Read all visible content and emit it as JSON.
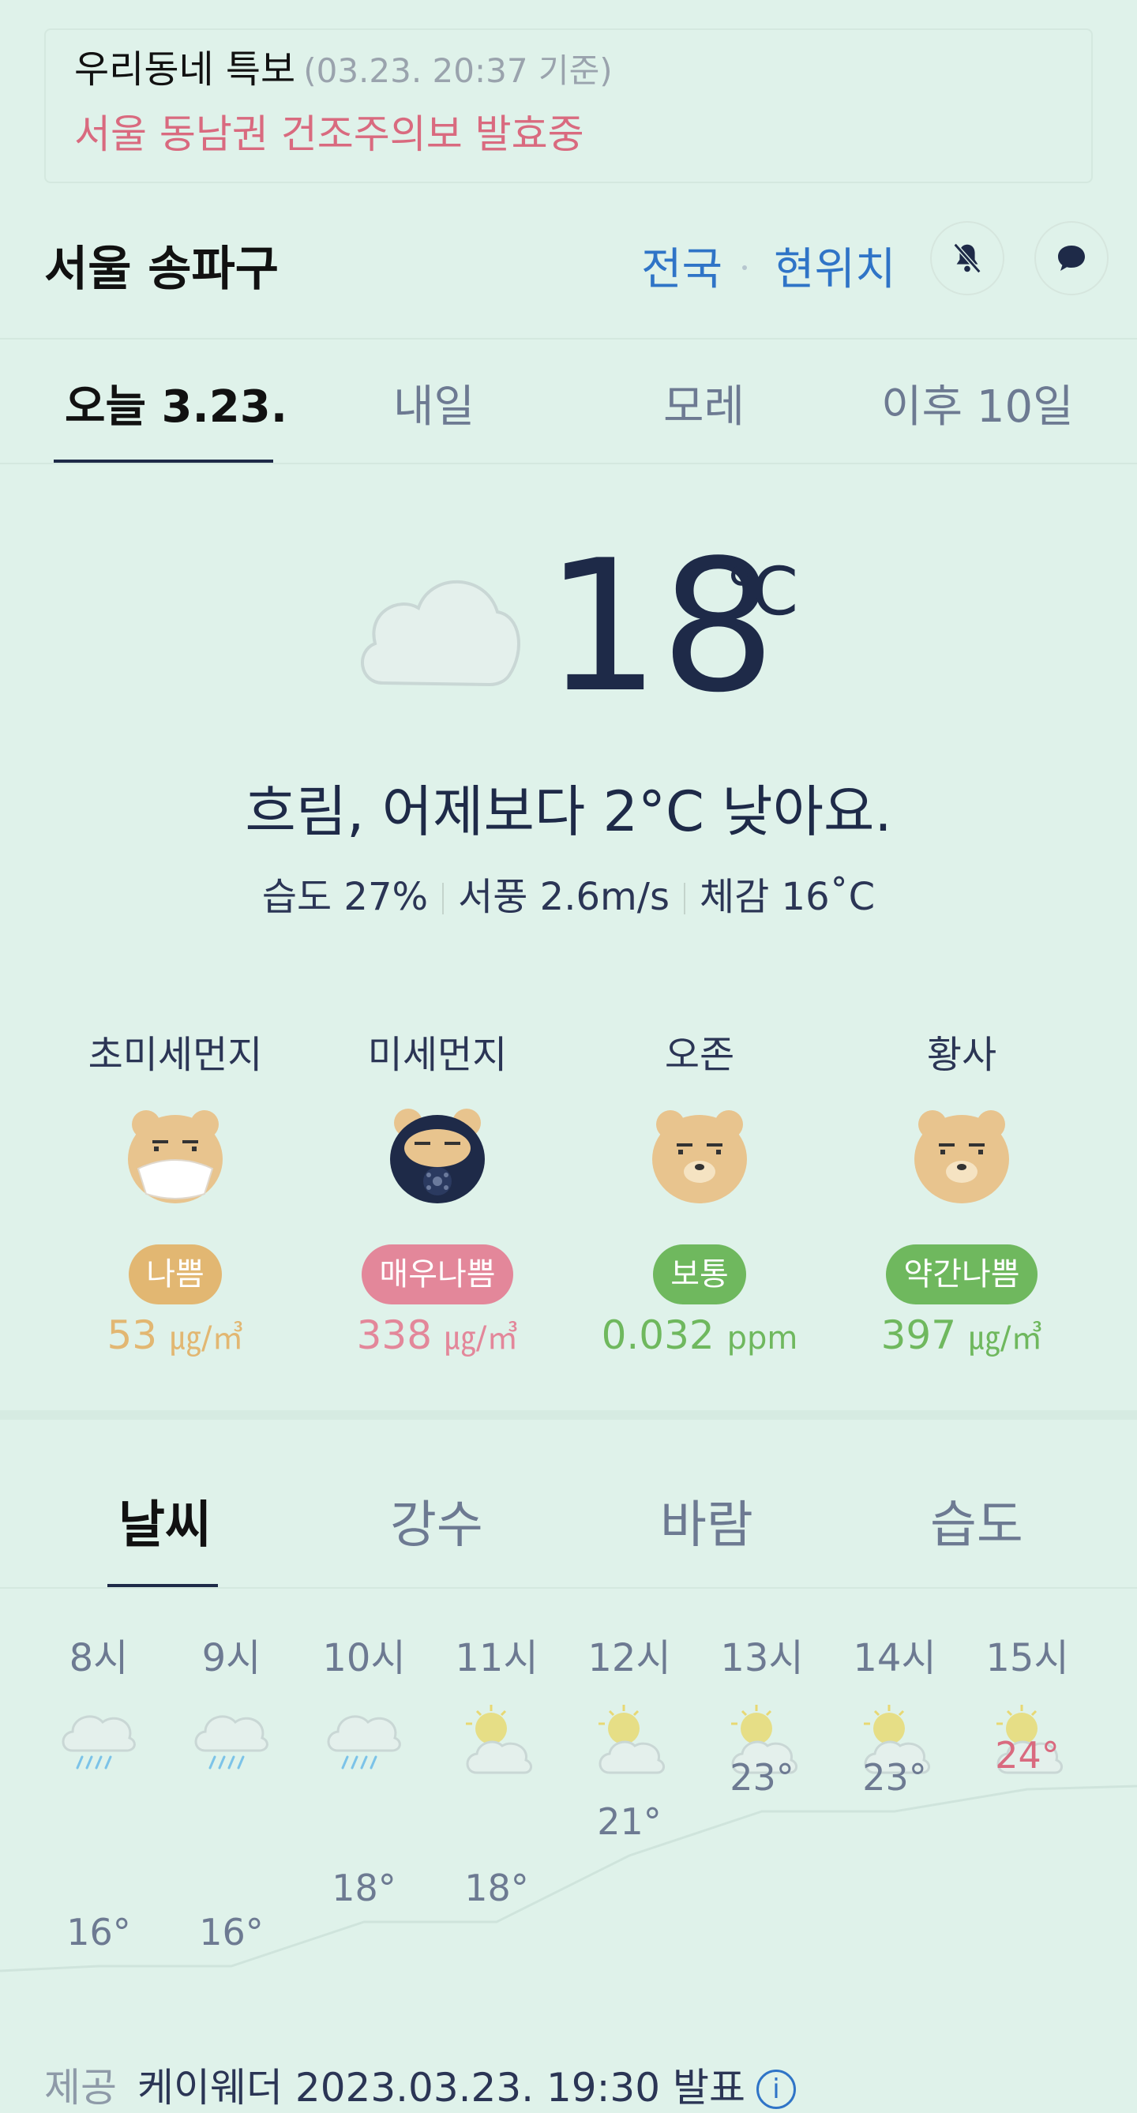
{
  "alert": {
    "title": "우리동네 특보",
    "time": "(03.23. 20:37 기준)",
    "message": "서울 동남권 건조주의보 발효중"
  },
  "header": {
    "location": "서울 송파구",
    "nation_link": "전국",
    "current_link": "현위치",
    "bell_icon": "bell-muted-icon",
    "chat_icon": "chat-bubble-icon"
  },
  "day_tabs": [
    "오늘 3.23.",
    "내일",
    "모레",
    "이후 10일"
  ],
  "current": {
    "icon": "cloud-icon",
    "temperature": "18",
    "unit": "℃",
    "summary": "흐림, 어제보다 2°C 낮아요.",
    "humidity": "습도 27%",
    "wind": "서풍 2.6m/s",
    "feels_like": "체감 16˚C"
  },
  "air_quality": [
    {
      "label": "초미세먼지",
      "status": "나쁨",
      "value": "53",
      "unit": "㎍/㎥",
      "color": "#e2b772",
      "face": "bear-mask-icon"
    },
    {
      "label": "미세먼지",
      "status": "매우나쁨",
      "value": "338",
      "unit": "㎍/㎥",
      "color": "#e3879a",
      "face": "bear-gasmask-icon"
    },
    {
      "label": "오존",
      "status": "보통",
      "value": "0.032",
      "unit": "ppm",
      "color": "#6fb85e",
      "face": "bear-icon"
    },
    {
      "label": "황사",
      "status": "약간나쁨",
      "value": "397",
      "unit": "㎍/㎥",
      "color": "#6fb85e",
      "face": "bear-icon"
    }
  ],
  "forecast_tabs": [
    "날씨",
    "강수",
    "바람",
    "습도"
  ],
  "hourly": [
    {
      "hour": "8시",
      "icon": "rain-icon",
      "temp": "16°",
      "value": 16
    },
    {
      "hour": "9시",
      "icon": "rain-icon",
      "temp": "16°",
      "value": 16
    },
    {
      "hour": "10시",
      "icon": "rain-icon",
      "temp": "18°",
      "value": 18
    },
    {
      "hour": "11시",
      "icon": "partly-sunny-icon",
      "temp": "18°",
      "value": 18
    },
    {
      "hour": "12시",
      "icon": "partly-sunny-icon",
      "temp": "21°",
      "value": 21
    },
    {
      "hour": "13시",
      "icon": "partly-sunny-icon",
      "temp": "23°",
      "value": 23
    },
    {
      "hour": "14시",
      "icon": "partly-sunny-icon",
      "temp": "23°",
      "value": 23
    },
    {
      "hour": "15시",
      "icon": "partly-sunny-icon",
      "temp": "24°",
      "value": 24,
      "highlight": true
    }
  ],
  "footer": {
    "label": "제공",
    "text": "케이웨더 2023.03.23. 19:30 발표",
    "info_icon": "info-icon"
  }
}
